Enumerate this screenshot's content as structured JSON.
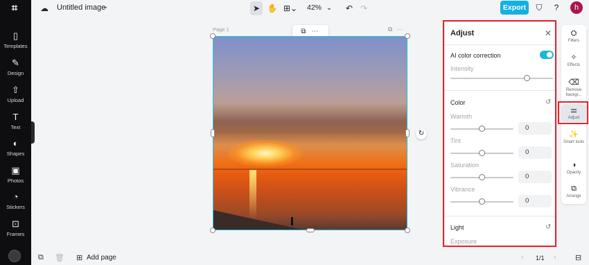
{
  "app": {
    "logo": "⌗"
  },
  "left_nav": [
    {
      "label": "Templates",
      "icon": "templates-icon",
      "glyph": "▯"
    },
    {
      "label": "Design",
      "icon": "design-icon",
      "glyph": "✎"
    },
    {
      "label": "Upload",
      "icon": "upload-icon",
      "glyph": "⇧"
    },
    {
      "label": "Text",
      "icon": "text-icon",
      "glyph": "T"
    },
    {
      "label": "Shapes",
      "icon": "shapes-icon",
      "glyph": "◐"
    },
    {
      "label": "Photos",
      "icon": "photos-icon",
      "glyph": "▣"
    },
    {
      "label": "Stickers",
      "icon": "stickers-icon",
      "glyph": "◔"
    },
    {
      "label": "Frames",
      "icon": "frames-icon",
      "glyph": "⊡"
    }
  ],
  "topbar": {
    "title": "Untitled image",
    "zoom": "42%",
    "export_label": "Export",
    "user_initial": "h"
  },
  "canvas": {
    "page_label": "Page 1"
  },
  "adjust": {
    "title": "Adjust",
    "ai_label": "AI color correction",
    "ai_enabled": true,
    "intensity_label": "Intensity",
    "intensity": 0.75,
    "color_section": "Color",
    "warmth_label": "Warmth",
    "warmth_value": "0",
    "tint_label": "Tint",
    "tint_value": "0",
    "saturation_label": "Saturation",
    "saturation_value": "0",
    "vibrance_label": "Vibrance",
    "vibrance_value": "0",
    "light_section": "Light",
    "exposure_label": "Exposure"
  },
  "right_tools": [
    {
      "label": "Filters",
      "icon": "filters-icon",
      "glyph": "⛭"
    },
    {
      "label": "Effects",
      "icon": "effects-icon",
      "glyph": "✧"
    },
    {
      "label": "Remove backgr...",
      "icon": "remove-background-icon",
      "glyph": "⌫"
    },
    {
      "label": "Adjust",
      "icon": "adjust-icon",
      "glyph": "⚌",
      "active": true
    },
    {
      "label": "Smart tools",
      "icon": "smart-tools-icon",
      "glyph": "✨"
    },
    {
      "label": "Opacity",
      "icon": "opacity-icon",
      "glyph": "◑"
    },
    {
      "label": "Arrange",
      "icon": "arrange-icon",
      "glyph": "⧉"
    }
  ],
  "bottombar": {
    "add_page_label": "Add page",
    "pager": "1/1"
  },
  "colors": {
    "accent": "#13b0e2",
    "highlight": "#e8212b",
    "left_rail": "#0e0e10"
  }
}
